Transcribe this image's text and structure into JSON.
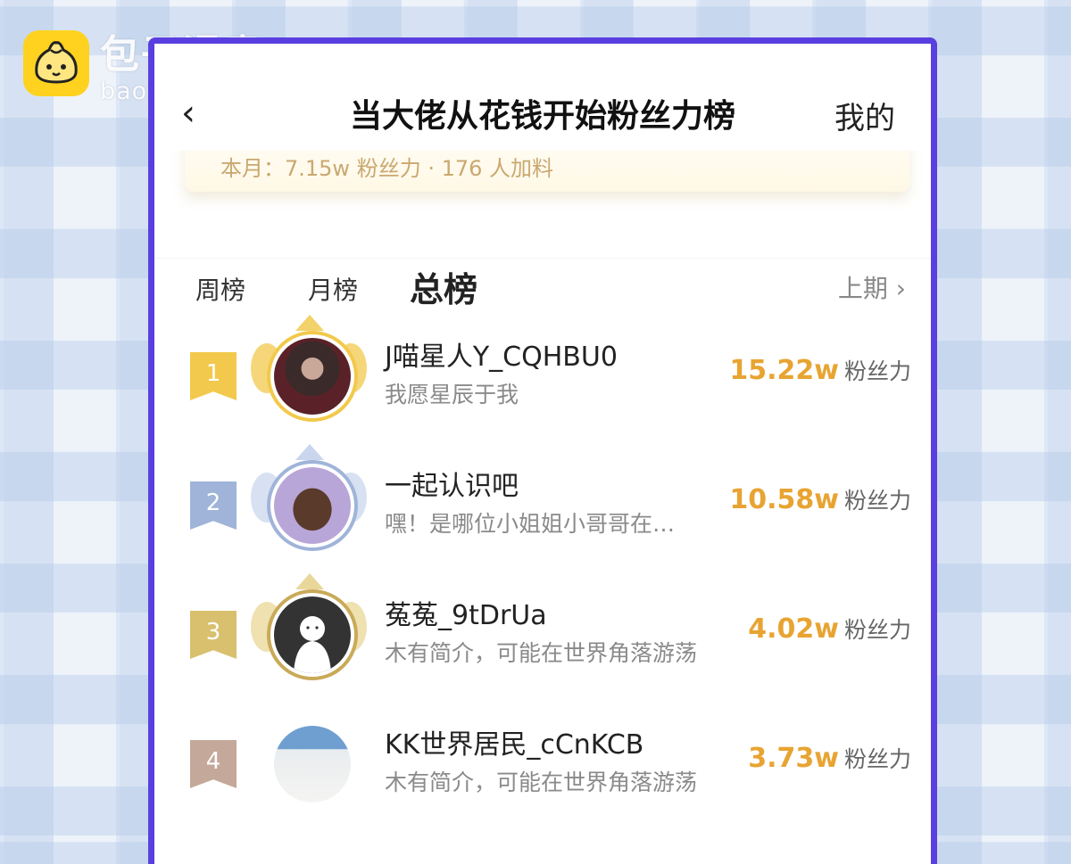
{
  "watermark": {
    "name": "包子漫畫",
    "url": "baozimh.com"
  },
  "nav": {
    "back_icon": "‹",
    "title": "当大佬从花钱开始粉丝力榜",
    "mine": "我的"
  },
  "month_summary": "本月：7.15w 粉丝力 · 176 人加料",
  "tabs": {
    "weekly": "周榜",
    "monthly": "月榜",
    "total": "总榜",
    "active": "总榜",
    "previous": "上期 ›"
  },
  "ranking": [
    {
      "rank": "1",
      "name": "J喵星人Y_CQHBU0",
      "bio": "我愿星辰于我",
      "score": "15.22w",
      "unit": "粉丝力"
    },
    {
      "rank": "2",
      "name": "一起认识吧",
      "bio": "嘿！是哪位小姐姐小哥哥在…",
      "score": "10.58w",
      "unit": "粉丝力"
    },
    {
      "rank": "3",
      "name": "菟菟_9tDrUa",
      "bio": "木有简介，可能在世界角落游荡",
      "score": "4.02w",
      "unit": "粉丝力"
    },
    {
      "rank": "4",
      "name": "KK世界居民_cCnKCB",
      "bio": "木有简介，可能在世界角落游荡",
      "score": "3.73w",
      "unit": "粉丝力"
    }
  ],
  "colors": {
    "frame": "#5a3fe0",
    "rank1": "#f2c94c",
    "rank2": "#9fb4d8",
    "rank3": "#d8c06e",
    "rank4": "#c4a89a",
    "score": "#e8a432"
  }
}
